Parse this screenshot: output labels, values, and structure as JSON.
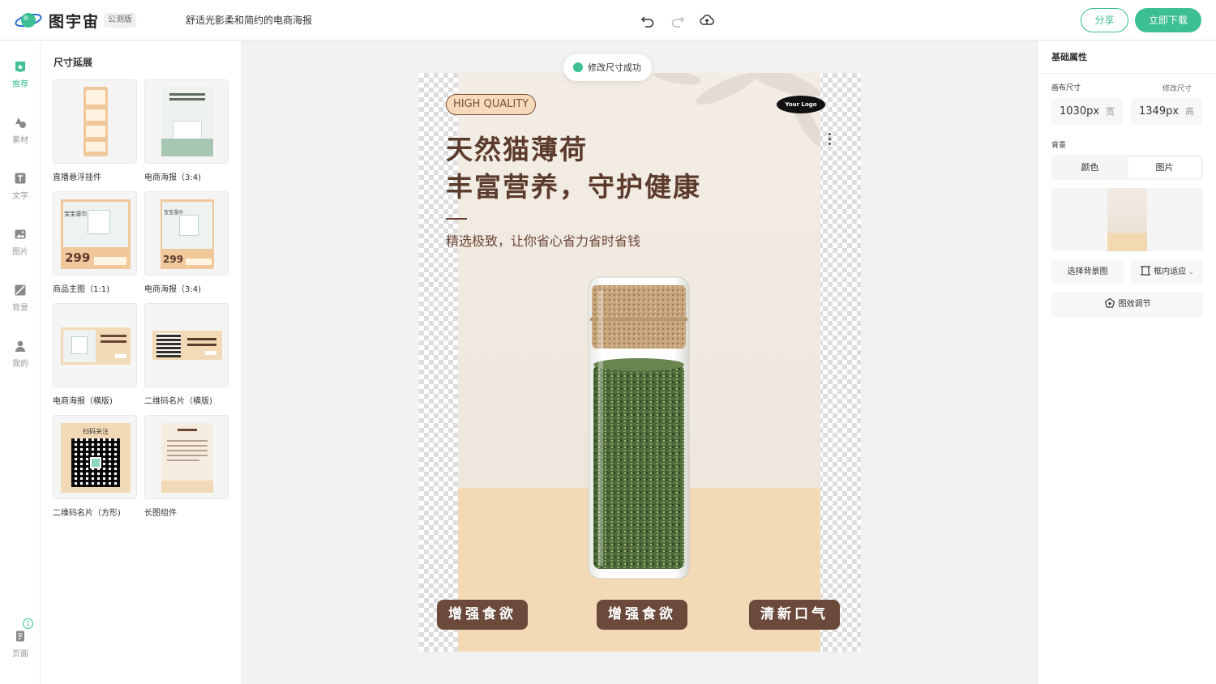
{
  "header": {
    "brand": "图宇宙",
    "badge": "公测版",
    "doc_title": "舒适光影柔和简约的电商海报",
    "share_label": "分享",
    "download_label": "立即下载"
  },
  "rail": {
    "items": [
      {
        "label": "推荐"
      },
      {
        "label": "素材"
      },
      {
        "label": "文字"
      },
      {
        "label": "图片"
      },
      {
        "label": "背景"
      },
      {
        "label": "我的"
      }
    ],
    "pages_label": "页面",
    "pages_count": "1"
  },
  "templates": {
    "title": "尺寸延展",
    "items": [
      {
        "label": "直播悬浮挂件"
      },
      {
        "label": "电商海报（3:4)"
      },
      {
        "label": "商品主图（1:1)"
      },
      {
        "label": "电商海报（3:4)"
      },
      {
        "label": "电商海报（横版)"
      },
      {
        "label": "二维码名片（横版)"
      },
      {
        "label": "二维码名片（方形)"
      },
      {
        "label": "长图组件"
      }
    ],
    "thumb_text": {
      "scan": "扫码关注",
      "price": "299",
      "brand": "宝宝湿巾"
    }
  },
  "canvas": {
    "toast": "修改尺寸成功",
    "badge": "HIGH QUALITY",
    "logo": "Your Logo",
    "headline_1": "天然猫薄荷",
    "headline_2": "丰富营养，守护健康",
    "subline": "精选极致，让你省心省力省时省钱",
    "tags": [
      "增强食欲",
      "增强食欲",
      "清新口气"
    ]
  },
  "props": {
    "title": "基础属性",
    "canvas_size_label": "画布尺寸",
    "modify_size_label": "修改尺寸",
    "width_value": "1030px",
    "width_unit": "宽",
    "height_value": "1349px",
    "height_unit": "高",
    "background_label": "背景",
    "bg_tabs": [
      "颜色",
      "图片"
    ],
    "choose_bg_label": "选择背景图",
    "fit_label": "框内适应",
    "effect_label": "图效调节"
  },
  "colors": {
    "accent": "#3cbf93",
    "poster_text": "#5b3b2c",
    "tag_bg": "#6b4a3c"
  }
}
